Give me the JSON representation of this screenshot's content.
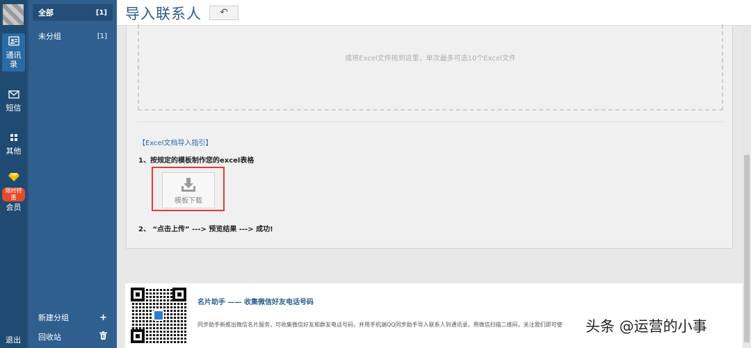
{
  "rail": {
    "items": [
      {
        "label_line1": "通讯",
        "label_line2": "录",
        "icon": "contacts-icon"
      },
      {
        "label": "短信",
        "icon": "mail-icon"
      },
      {
        "label": "其他",
        "icon": "grid-icon"
      },
      {
        "label": "会员",
        "icon": "diamond-icon",
        "badge": "限时特惠"
      }
    ],
    "logout": "退出"
  },
  "groups": {
    "items": [
      {
        "label": "全部",
        "count": "[1]"
      },
      {
        "label": "未分组",
        "count": "[1]"
      }
    ],
    "new_group": "新建分组",
    "new_group_icon": "+",
    "recycle": "回收站"
  },
  "header": {
    "title": "导入联系人",
    "back_icon": "↶"
  },
  "main": {
    "drop_hint": "或将Excel文件拖到这里，单次最多可选10个Excel文件",
    "guide_title": "【Excel文档导入指引】",
    "step1": "1、按规定的模板制作您的excel表格",
    "template_button": "模板下载",
    "step2": "2、 “点击上传” ---> 预览结果 ---> 成功!"
  },
  "promo": {
    "title": "名片助手 —— 收集微信好友电话号码",
    "desc": "同步助手新推出微信名片服务，可收集微信好友和群友电话号码，并用手机端QQ同步助手导入联系人到通讯录。用微信扫描二维码，关注我们即可使"
  },
  "watermark": "头条 @运营的小事",
  "colors": {
    "rail_bg": "#1f4a72",
    "groups_bg": "#2e5f8f",
    "title": "#2c5a86",
    "highlight_border": "#e53935",
    "guide_title": "#2a6cae"
  }
}
